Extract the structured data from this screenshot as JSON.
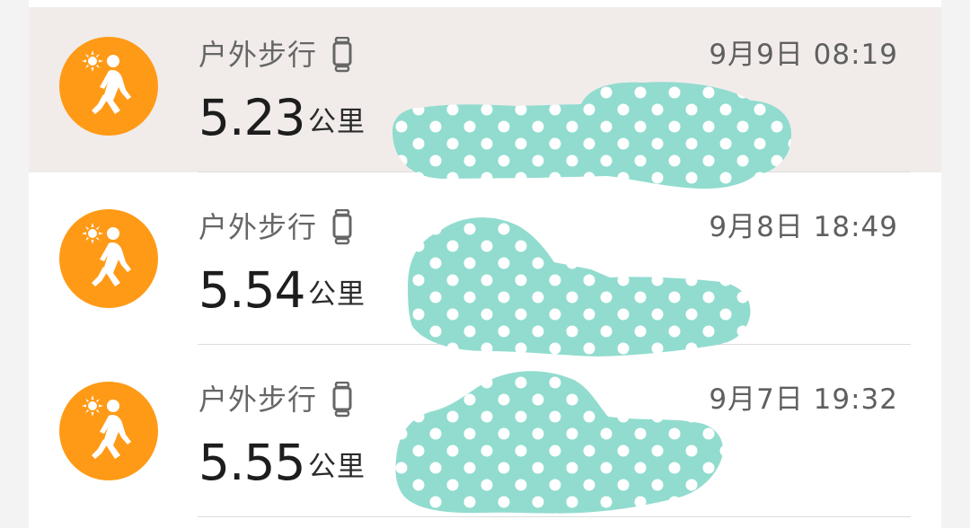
{
  "activities": [
    {
      "title": "户外步行",
      "datetime": "9月9日 08:19",
      "distance": "5.23",
      "unit": "公里",
      "selected": true
    },
    {
      "title": "户外步行",
      "datetime": "9月8日 18:49",
      "distance": "5.54",
      "unit": "公里",
      "selected": false
    },
    {
      "title": "户外步行",
      "datetime": "9月7日 19:32",
      "distance": "5.55",
      "unit": "公里",
      "selected": false
    }
  ],
  "icons": {
    "activity": "outdoor-walk-icon",
    "device": "wearable-band-icon"
  },
  "colors": {
    "accent": "#ff9a17",
    "selected_row": "#f1ecea",
    "redaction": "#91dccf"
  }
}
